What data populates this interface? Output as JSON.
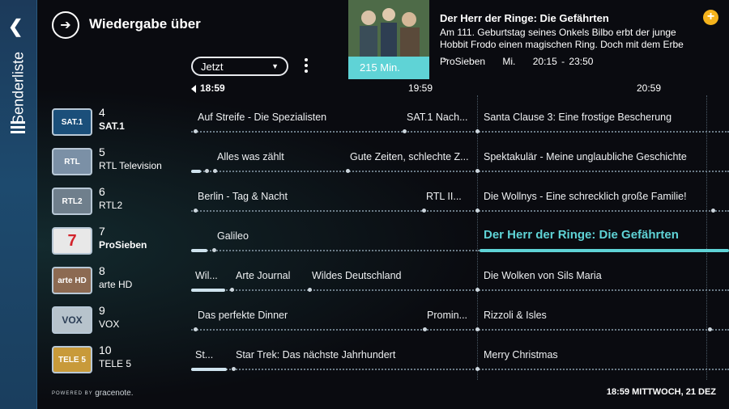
{
  "sidebar": {
    "back_icon": "chevron-left-icon",
    "label": "Senderliste",
    "menu_icon": "menu-icon"
  },
  "header": {
    "title": "Wiedergabe über",
    "icon": "cast-icon"
  },
  "dropdown": {
    "value": "Jetzt"
  },
  "program": {
    "duration": "215 Min.",
    "title": "Der Herr der Ringe: Die Gefährten",
    "description": "Am 111. Geburtstag seines Onkels Bilbo erbt der junge Hobbit Frodo einen magischen Ring. Doch mit dem Erbe ...",
    "channel": "ProSieben",
    "day": "Mi.",
    "time": "20:15 - 23:50",
    "add_icon": "plus-icon"
  },
  "timebar": {
    "current": "18:59",
    "t1": "19:59",
    "t2": "20:59"
  },
  "channels": [
    {
      "number": "4",
      "name": "SAT.1",
      "logo": "SAT.1",
      "bold": true,
      "programs": [
        "Auf Streife - Die Spezialisten",
        "SAT.1 Nach...",
        "Santa Clause 3: Eine frostige Bescherung"
      ]
    },
    {
      "number": "5",
      "name": "RTL Television",
      "logo": "RTL",
      "programs": [
        "Alles was zählt",
        "Gute Zeiten, schlechte Z...",
        "Spektakulär - Meine unglaubliche Geschichte"
      ]
    },
    {
      "number": "6",
      "name": "RTL2",
      "logo": "RTL2",
      "programs": [
        "Berlin - Tag & Nacht",
        "RTL II...",
        "Die Wollnys - Eine schrecklich große Familie!"
      ]
    },
    {
      "number": "7",
      "name": "ProSieben",
      "logo": "7",
      "bold": true,
      "programs": [
        "Galileo",
        "Der Herr der Ringe: Die Gefährten"
      ]
    },
    {
      "number": "8",
      "name": "arte HD",
      "logo": "arte HD",
      "programs": [
        "Wil...",
        "Arte Journal",
        "Wildes Deutschland",
        "Die Wolken von Sils Maria"
      ]
    },
    {
      "number": "9",
      "name": "VOX",
      "logo": "VOX",
      "programs": [
        "Das perfekte Dinner",
        "Promin...",
        "Rizzoli & Isles"
      ]
    },
    {
      "number": "10",
      "name": "TELE 5",
      "logo": "TELE 5",
      "programs": [
        "St...",
        "Star Trek: Das nächste Jahrhundert",
        "Merry Christmas"
      ]
    }
  ],
  "footer": {
    "powered": "POWERED BY",
    "brand": "gracenote.",
    "clock": "18:59 MITTWOCH, 21 DEZ"
  },
  "colors": {
    "accent": "#5fd3d6",
    "add": "#f5b31c",
    "sidebar": "#1d4a6e"
  }
}
